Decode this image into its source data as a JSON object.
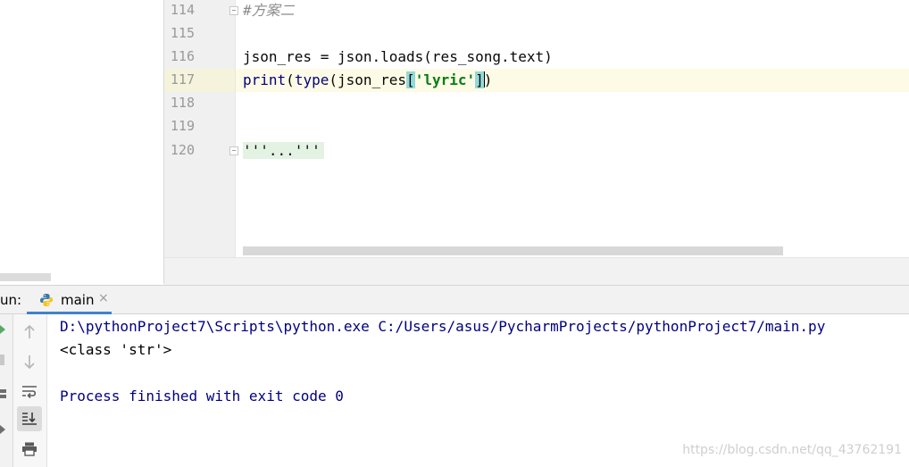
{
  "editor": {
    "lines": [
      {
        "num": "114",
        "text": "#方案二"
      },
      {
        "num": "115",
        "text": ""
      },
      {
        "num": "116",
        "text": "json_res = json.loads(res_song.text)"
      },
      {
        "num": "117",
        "fn1": "print",
        "mid1": "(",
        "fn2": "type",
        "mid2": "(json_res",
        "lb": "[",
        "str": "'lyric'",
        "rb": "]",
        "tail": ")"
      },
      {
        "num": "118",
        "text": ""
      },
      {
        "num": "119",
        "text": ""
      },
      {
        "num": "120",
        "text": "'''...'''"
      }
    ],
    "current_line": "117"
  },
  "run_panel": {
    "label": "un:",
    "tab_name": "main",
    "tab_close": "×",
    "icons": [
      "play-icon",
      "stop-icon",
      "scroll-up-icon",
      "scroll-down-icon",
      "soft-wrap-icon",
      "scroll-to-end-icon",
      "print-icon",
      "pin-icon"
    ],
    "console_lines": [
      "D:\\pythonProject7\\Scripts\\python.exe C:/Users/asus/PycharmProjects/pythonProject7/main.py",
      "<class 'str'>",
      "",
      "Process finished with exit code 0"
    ]
  },
  "watermark": "https://blog.csdn.net/qq_43762191",
  "colors": {
    "accent": "#4083c9",
    "string": "#067d17",
    "builtin": "#000080",
    "bracket_highlight": "#93d9d9"
  }
}
